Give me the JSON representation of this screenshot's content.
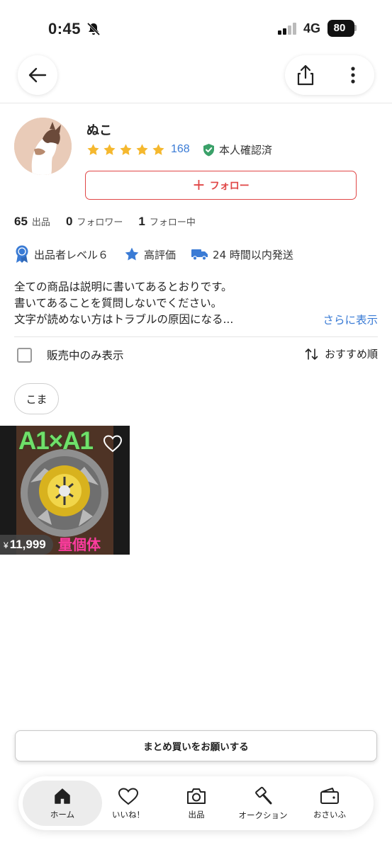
{
  "status_bar": {
    "time": "0:45",
    "network": "4G",
    "battery": "80"
  },
  "seller": {
    "name": "ぬこ",
    "rating_count": "168",
    "verified_label": "本人確認済",
    "follow_label": "フォロー"
  },
  "stats": [
    {
      "value": "65",
      "label": "出品"
    },
    {
      "value": "0",
      "label": "フォロワー"
    },
    {
      "value": "1",
      "label": "フォロー中"
    }
  ],
  "badges": [
    {
      "label": "出品者レベル６",
      "icon": "medal-icon"
    },
    {
      "label": "高評価",
      "icon": "star-icon"
    },
    {
      "label": "24 時間以内発送",
      "icon": "truck-icon"
    }
  ],
  "description": {
    "lines": [
      "全ての商品は説明に書いてあるとおりです。",
      "書いてあることを質問しないでください。",
      "文字が読めない方はトラブルの原因になる..."
    ],
    "more_label": "さらに表示"
  },
  "filter": {
    "on_sale_only_label": "販売中のみ表示",
    "sort_label": "おすすめ順"
  },
  "tags": [
    "こま"
  ],
  "products": [
    {
      "image_text": "A1×A1",
      "caption": "量個体",
      "currency": "¥",
      "price": "11,999"
    }
  ],
  "bundle_button_label": "まとめ買いをお願いする",
  "nav": [
    {
      "label": "ホーム",
      "icon": "home-icon"
    },
    {
      "label": "いいね！",
      "icon": "heart-icon"
    },
    {
      "label": "出品",
      "icon": "camera-icon"
    },
    {
      "label": "オークション",
      "icon": "gavel-icon"
    },
    {
      "label": "おさいふ",
      "icon": "wallet-icon"
    }
  ],
  "colors": {
    "accent_red": "#e04646",
    "link_blue": "#3a7bd5",
    "star_yellow": "#f5b82e",
    "verified_green": "#3aa169"
  }
}
